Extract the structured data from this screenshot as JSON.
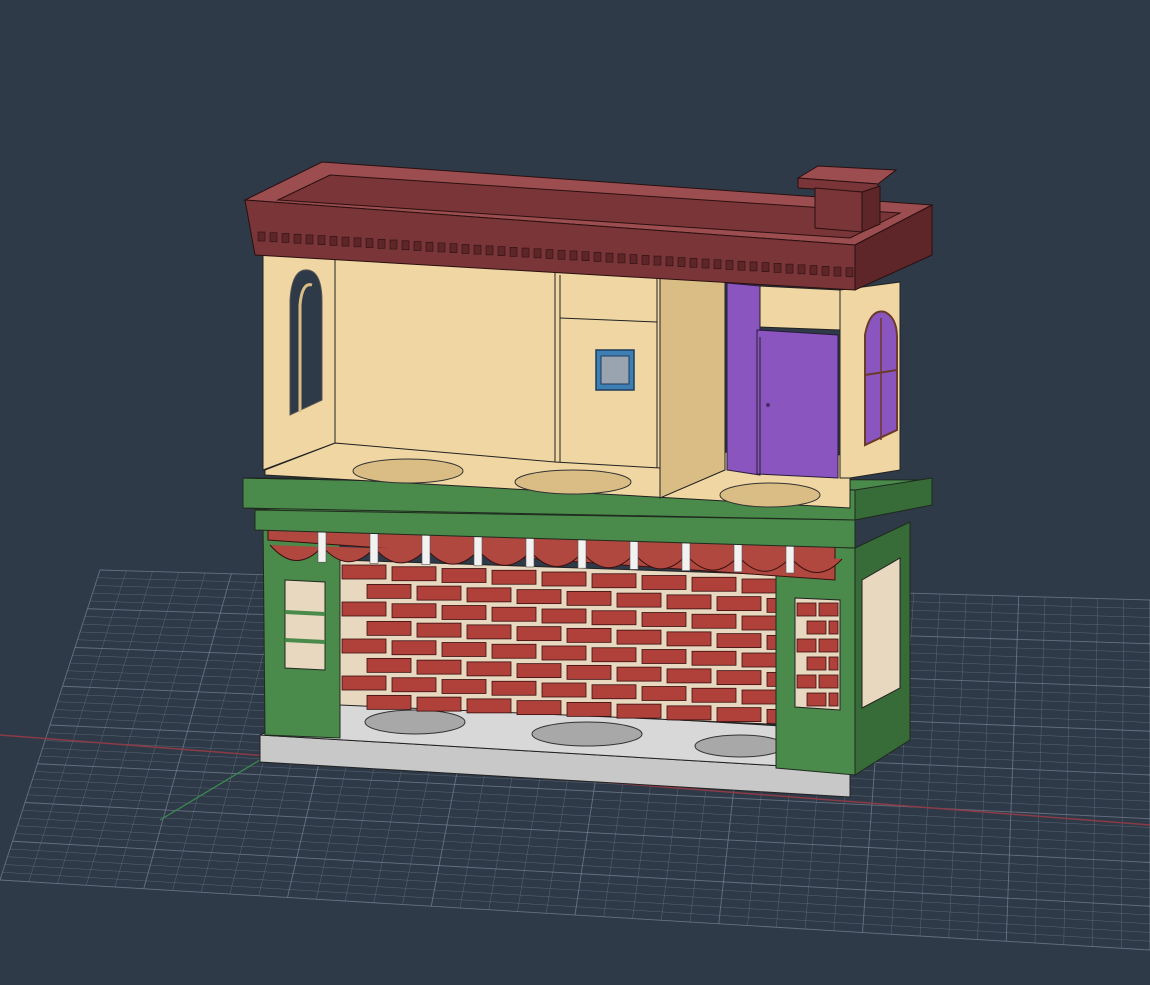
{
  "viewport": {
    "background": "#2e3a48",
    "grid_color": "#7c8898",
    "x_axis_color": "#8a3b45",
    "y_axis_color": "#3c8a52"
  },
  "model": {
    "colors": {
      "roof": "#7a3538",
      "roof_top": "#9c4d4f",
      "wall_cream": "#efd6a2",
      "wall_cream_dark": "#d9bd85",
      "door_purple": "#8a55be",
      "trim_green": "#4a8a4a",
      "trim_green_dark": "#376b38",
      "brick": "#b0403a",
      "mortar": "#e8d8c0",
      "awning_red": "#b04840",
      "awning_white": "#f2f2f2",
      "base_grey": "#c8c8c8",
      "glass_blue": "#9fc8e0"
    }
  }
}
